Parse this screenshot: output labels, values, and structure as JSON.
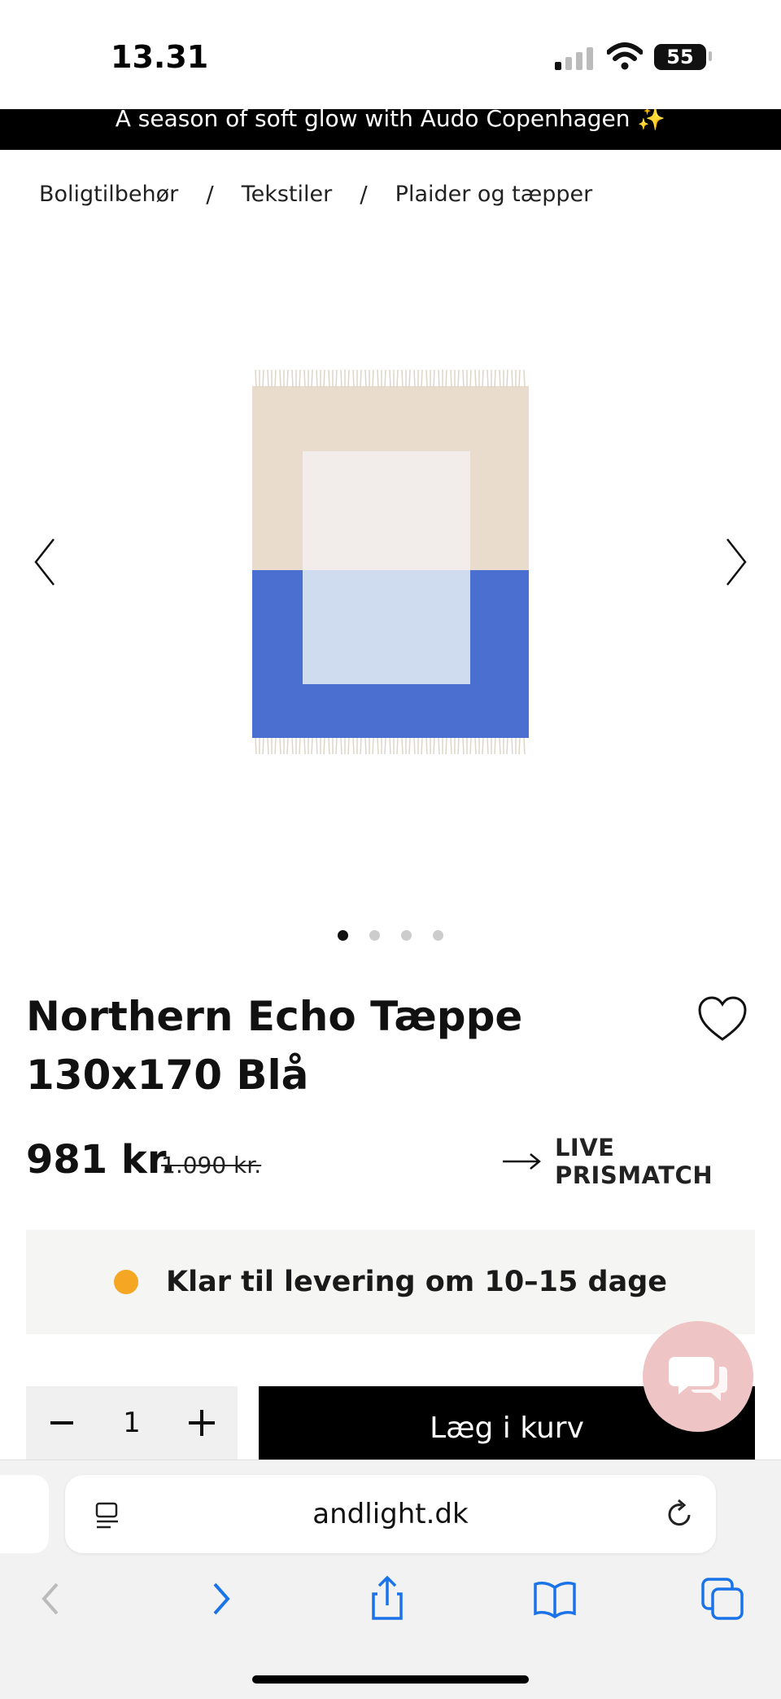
{
  "status_bar": {
    "time": "13.31",
    "battery": "55"
  },
  "announcement": "A season of soft glow with Audo Copenhagen ✨",
  "breadcrumb": {
    "items": [
      "Boligtilbehør",
      "Tekstiler",
      "Plaider og tæpper"
    ],
    "separator": "/"
  },
  "gallery": {
    "image_count": 4,
    "active_index": 0,
    "image_colors": {
      "top": "#e9dccd",
      "bottom": "#4a6fd1",
      "inner_top": "#f2ecea",
      "inner_bottom": "#cfdcf0",
      "fringe": "#ece6da"
    }
  },
  "product": {
    "title": "Northern Echo Tæppe 130x170 Blå",
    "price": "981 kr.",
    "old_price": "1.090 kr.",
    "prismatch_label": "LIVE PRISMATCH"
  },
  "delivery": {
    "text": "Klar til levering om 10–15 dage",
    "status_color": "#f5a623"
  },
  "cart": {
    "quantity": "1",
    "add_label": "Læg i kurv"
  },
  "browser": {
    "url": "andlight.dk",
    "accent_color": "#1a73e8"
  },
  "colors": {
    "chat_bubble": "#efc4c4",
    "announcement_bg": "#000000"
  }
}
